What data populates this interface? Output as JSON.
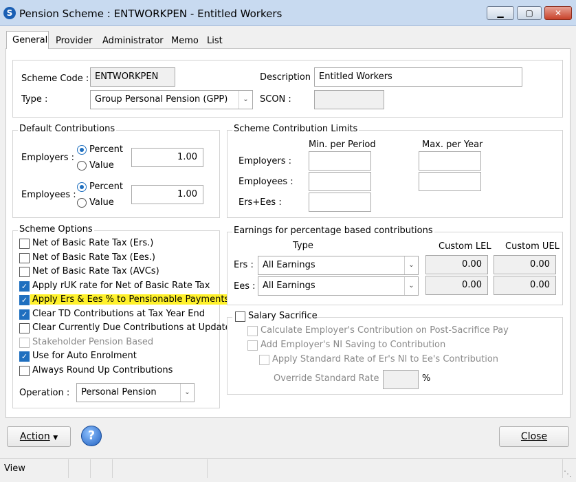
{
  "window": {
    "title": "Pension Scheme : ENTWORKPEN - Entitled Workers",
    "min": "▁",
    "max": "▢",
    "close": "✕"
  },
  "tabs": [
    "General",
    "Provider",
    "Administrator",
    "Memo",
    "List"
  ],
  "general": {
    "scheme_code_label": "Scheme Code :",
    "scheme_code": "ENTWORKPEN",
    "description_label": "Description :",
    "description": "Entitled Workers",
    "type_label": "Type :",
    "type_value": "Group Personal Pension (GPP)",
    "scon_label": "SCON :",
    "scon": ""
  },
  "default_contributions": {
    "title": "Default Contributions",
    "employers_label": "Employers :",
    "employees_label": "Employees :",
    "percent": "Percent",
    "value": "Value",
    "employers_amount": "1.00",
    "employees_amount": "1.00"
  },
  "limits": {
    "title": "Scheme Contribution Limits",
    "min_header": "Min. per Period",
    "max_header": "Max. per Year",
    "employers_label": "Employers :",
    "employees_label": "Employees :",
    "erses_label": "Ers+Ees :"
  },
  "scheme_options": {
    "title": "Scheme Options",
    "items": [
      {
        "label": "Net of Basic Rate Tax (Ers.)",
        "checked": false
      },
      {
        "label": "Net of Basic Rate Tax (Ees.)",
        "checked": false
      },
      {
        "label": "Net of Basic Rate Tax (AVCs)",
        "checked": false
      },
      {
        "label": "Apply rUK rate for Net of Basic Rate Tax",
        "checked": true
      },
      {
        "label": "Apply Ers & Ees % to Pensionable Payments",
        "checked": true
      },
      {
        "label": "Clear TD Contributions at Tax Year End",
        "checked": true
      },
      {
        "label": "Clear Currently Due Contributions at Update",
        "checked": false
      },
      {
        "label": "Stakeholder Pension Based",
        "checked": false
      },
      {
        "label": "Use for Auto Enrolment",
        "checked": true
      },
      {
        "label": "Always Round Up Contributions",
        "checked": false
      }
    ],
    "operation_label": "Operation :",
    "operation_value": "Personal Pension"
  },
  "earnings": {
    "title": "Earnings for percentage based contributions",
    "type_header": "Type",
    "lel_header": "Custom LEL",
    "uel_header": "Custom UEL",
    "ers_label": "Ers :",
    "ees_label": "Ees :",
    "ers_type": "All Earnings",
    "ees_type": "All Earnings",
    "ers_lel": "0.00",
    "ers_uel": "0.00",
    "ees_lel": "0.00",
    "ees_uel": "0.00"
  },
  "salary_sacrifice": {
    "title": "Salary Sacrifice",
    "opt1": "Calculate Employer's Contribution on Post-Sacrifice Pay",
    "opt2": "Add Employer's NI Saving to Contribution",
    "opt3": "Apply Standard Rate of Er's NI to Ee's Contribution",
    "override_label": "Override Standard Rate :",
    "override_value": "",
    "percent_sign": "%"
  },
  "footer": {
    "action": "Action",
    "help": "?",
    "close": "Close"
  },
  "status": {
    "text": "View"
  },
  "colors": {
    "highlight": "#fff12b",
    "accent": "#1f6fbf"
  }
}
